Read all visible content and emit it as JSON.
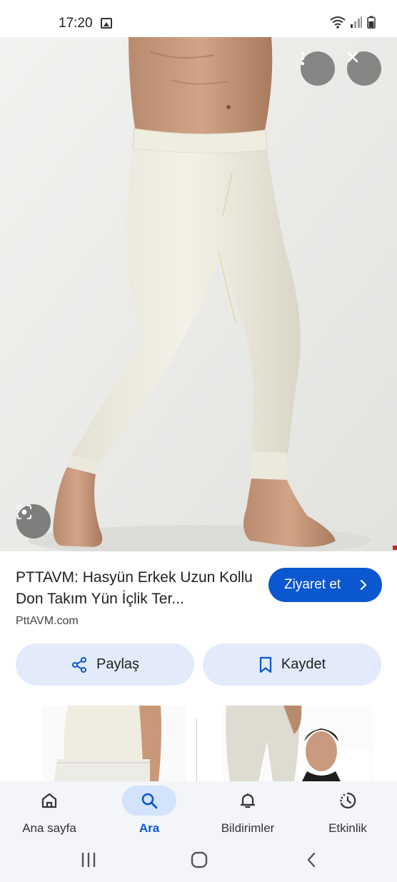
{
  "status_bar": {
    "time": "17:20",
    "icons": [
      "gallery-icon",
      "wifi-icon",
      "signal-icon",
      "battery-icon"
    ]
  },
  "viewer": {
    "buttons": [
      "more-options-icon",
      "close-icon",
      "lens-icon"
    ]
  },
  "result": {
    "title": "PTTAVM: Hasyün Erkek Uzun Kollu Don Takım Yün İçlik Ter...",
    "source": "PttAVM.com",
    "visit_label": "Ziyaret et"
  },
  "actions": {
    "share_label": "Paylaş",
    "save_label": "Kaydet"
  },
  "bottom_nav": {
    "items": [
      {
        "label": "Ana sayfa",
        "icon": "home-icon"
      },
      {
        "label": "Ara",
        "icon": "search-icon",
        "active": true
      },
      {
        "label": "Bildirimler",
        "icon": "bell-icon"
      },
      {
        "label": "Etkinlik",
        "icon": "activity-icon"
      }
    ]
  },
  "system_nav": [
    "recents-icon",
    "home-circle-icon",
    "back-icon"
  ],
  "colors": {
    "accent": "#0b57d0",
    "chip_bg": "#e3ebfa",
    "nav_active_bg": "#d3e3fd",
    "nav_bg": "#f3f5f9"
  }
}
